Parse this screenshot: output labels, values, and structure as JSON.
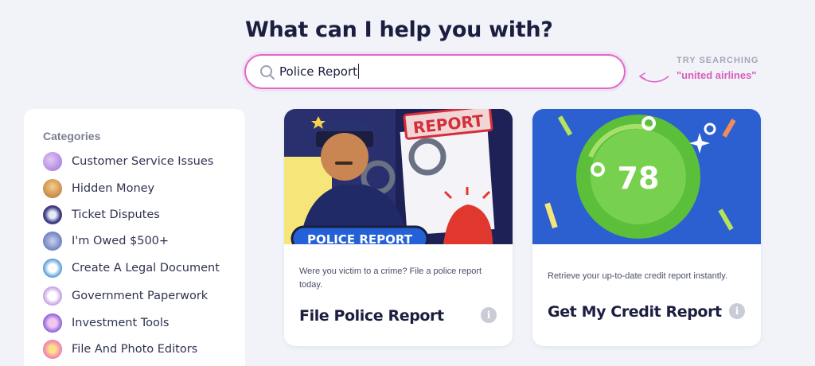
{
  "headline": "What can I help you with?",
  "search": {
    "value": "Police Report"
  },
  "try_searching": {
    "label": "TRY SEARCHING",
    "term": "\"united airlines\""
  },
  "sidebar": {
    "title": "Categories",
    "items": [
      {
        "label": "Customer Service Issues",
        "icon": "customer-service-icon",
        "color": "#b48be0"
      },
      {
        "label": "Hidden Money",
        "icon": "hidden-money-icon",
        "color": "#e8a65a"
      },
      {
        "label": "Ticket Disputes",
        "icon": "ticket-disputes-icon",
        "color": "#3d4a9a"
      },
      {
        "label": "I'm Owed $500+",
        "icon": "owed-money-icon",
        "color": "#6f86c9"
      },
      {
        "label": "Create A Legal Document",
        "icon": "legal-document-icon",
        "color": "#5aa6e0"
      },
      {
        "label": "Government Paperwork",
        "icon": "government-paperwork-icon",
        "color": "#c9a4e6"
      },
      {
        "label": "Investment Tools",
        "icon": "investment-tools-icon",
        "color": "#8a6de0"
      },
      {
        "label": "File And Photo Editors",
        "icon": "photo-editor-icon",
        "color": "#f07ab2"
      }
    ]
  },
  "cards": [
    {
      "banner": "POLICE REPORT",
      "stamp": "REPORT",
      "description": "Were you victim to a crime? File a police report today.",
      "title": "File Police Report",
      "info": "i"
    },
    {
      "score": "78",
      "description": "Retrieve your up-to-date credit report instantly.",
      "title": "Get My Credit Report",
      "info": "i"
    }
  ]
}
